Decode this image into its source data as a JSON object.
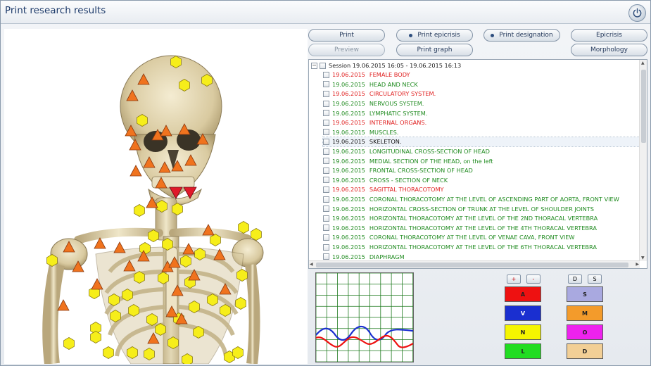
{
  "window": {
    "title": "Print research results",
    "power_icon": "power-icon"
  },
  "toolbar": {
    "print": "Print",
    "print_epicrisis": "Print epicrisis",
    "print_designation": "Print designation",
    "epicrisis": "Epicrisis",
    "preview": "Preview",
    "print_graph": "Print graph",
    "morphology": "Morphology"
  },
  "tree": {
    "session": "Session 19.06.2015 16:05 - 19.06.2015 16:13",
    "expander": "−",
    "colors": {
      "red": "#e02020",
      "green": "#1e8a1e",
      "black": "#111111"
    },
    "items": [
      {
        "date": "19.06.2015",
        "name": "FEMALE BODY",
        "color": "red"
      },
      {
        "date": "19.06.2015",
        "name": "HEAD AND NECK",
        "color": "green"
      },
      {
        "date": "19.06.2015",
        "name": "CIRCULATORY SYSTEM.",
        "color": "red"
      },
      {
        "date": "19.06.2015",
        "name": "NERVOUS SYSTEM.",
        "color": "green"
      },
      {
        "date": "19.06.2015",
        "name": "LYMPHATIC SYSTEM.",
        "color": "green"
      },
      {
        "date": "19.06.2015",
        "name": "INTERNAL ORGANS.",
        "color": "red"
      },
      {
        "date": "19.06.2015",
        "name": "MUSCLES.",
        "color": "green"
      },
      {
        "date": "19.06.2015",
        "name": "SKELETON.",
        "color": "black",
        "selected": true
      },
      {
        "date": "19.06.2015",
        "name": "LONGITUDINAL CROSS-SECTION OF HEAD",
        "color": "green"
      },
      {
        "date": "19.06.2015",
        "name": "MEDIAL SECTION OF THE HEAD, on the left",
        "color": "green"
      },
      {
        "date": "19.06.2015",
        "name": "FRONTAL CROSS-SECTION OF HEAD",
        "color": "green"
      },
      {
        "date": "19.06.2015",
        "name": "CROSS - SECTION  OF   NECK",
        "color": "green"
      },
      {
        "date": "19.06.2015",
        "name": "SAGITTAL THORACOTOMY",
        "color": "red"
      },
      {
        "date": "19.06.2015",
        "name": "CORONAL THORACOTOMY AT THE LEVEL OF ASCENDING PART OF AORTA, FRONT VIEW",
        "color": "green"
      },
      {
        "date": "19.06.2015",
        "name": "HORIZONTAL CROSS-SECTION OF TRUNK AT THE LEVEL OF SHOULDER JOINTS",
        "color": "green"
      },
      {
        "date": "19.06.2015",
        "name": "HORIZONTAL THORACOTOMY AT THE LEVEL OF THE 2ND THORACAL VERTEBRA",
        "color": "green"
      },
      {
        "date": "19.06.2015",
        "name": "HORIZONTAL THORACOTOMY AT THE LEVEL OF THE 4TH THORACAL VERTEBRA",
        "color": "green"
      },
      {
        "date": "19.06.2015",
        "name": "CORONAL THORACOTOMY AT THE LEVEL OF VENAE CAVA, FRONT VIEW",
        "color": "green"
      },
      {
        "date": "19.06.2015",
        "name": "HORIZONTAL THORACOTOMY AT THE LEVEL OF THE 6TH THORACAL VERTEBRA",
        "color": "green"
      },
      {
        "date": "19.06.2015",
        "name": "DIAPHRAGM",
        "color": "green"
      }
    ]
  },
  "controls": {
    "plus": "+",
    "minus": "-",
    "d": "D",
    "s": "S",
    "left_buttons": [
      {
        "label": "A",
        "color": "#ee1111"
      },
      {
        "label": "V",
        "color": "#1a2fd0"
      },
      {
        "label": "N",
        "color": "#f5f500"
      },
      {
        "label": "L",
        "color": "#22dd22"
      }
    ],
    "right_buttons": [
      {
        "label": "S",
        "color": "#a9a9e0"
      },
      {
        "label": "M",
        "color": "#f39b2b"
      },
      {
        "label": "O",
        "color": "#ee22ee"
      },
      {
        "label": "D",
        "color": "#f2cf96"
      }
    ]
  },
  "graph": {
    "series_colors": [
      "#1a2fd0",
      "#ee1111"
    ],
    "grid_color": "#1e7a1e"
  },
  "skeleton_image": {
    "marker_colors": {
      "hexagon": "#f6ee1a",
      "triangle": "#f0731e",
      "triangle_inverted": "#e01a2a"
    }
  }
}
